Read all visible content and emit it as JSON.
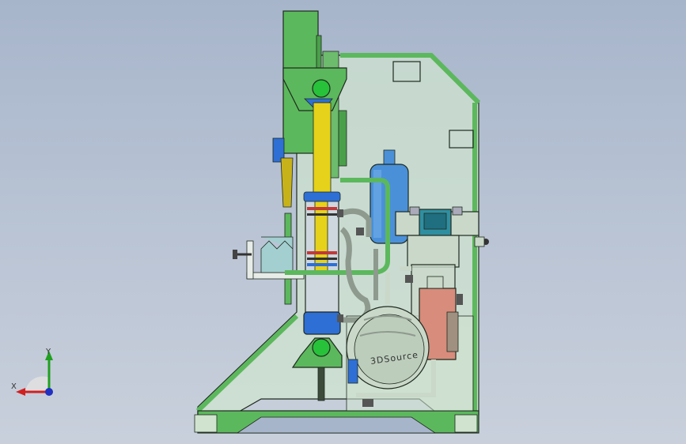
{
  "viewport": {
    "background_top": "#a7b5cb",
    "background_bottom": "#c9d0dc"
  },
  "model": {
    "motor_logo_text": "3DSource",
    "colors": {
      "frame": "#5cb85c",
      "panel": "#cfe3cf",
      "cylinder_rod": "#e6d21a",
      "blue_part": "#2e6fd6",
      "accumulator": "#4a90d9",
      "valve": "#2f8fa0",
      "motor": "#c9d8c9",
      "filter": "#d88c7c",
      "pipe": "#8e9a8e"
    }
  },
  "triad": {
    "x_label": "X",
    "y_label": "Y",
    "x_color": "#d02020",
    "y_color": "#20a020",
    "z_color": "#2030c0"
  }
}
